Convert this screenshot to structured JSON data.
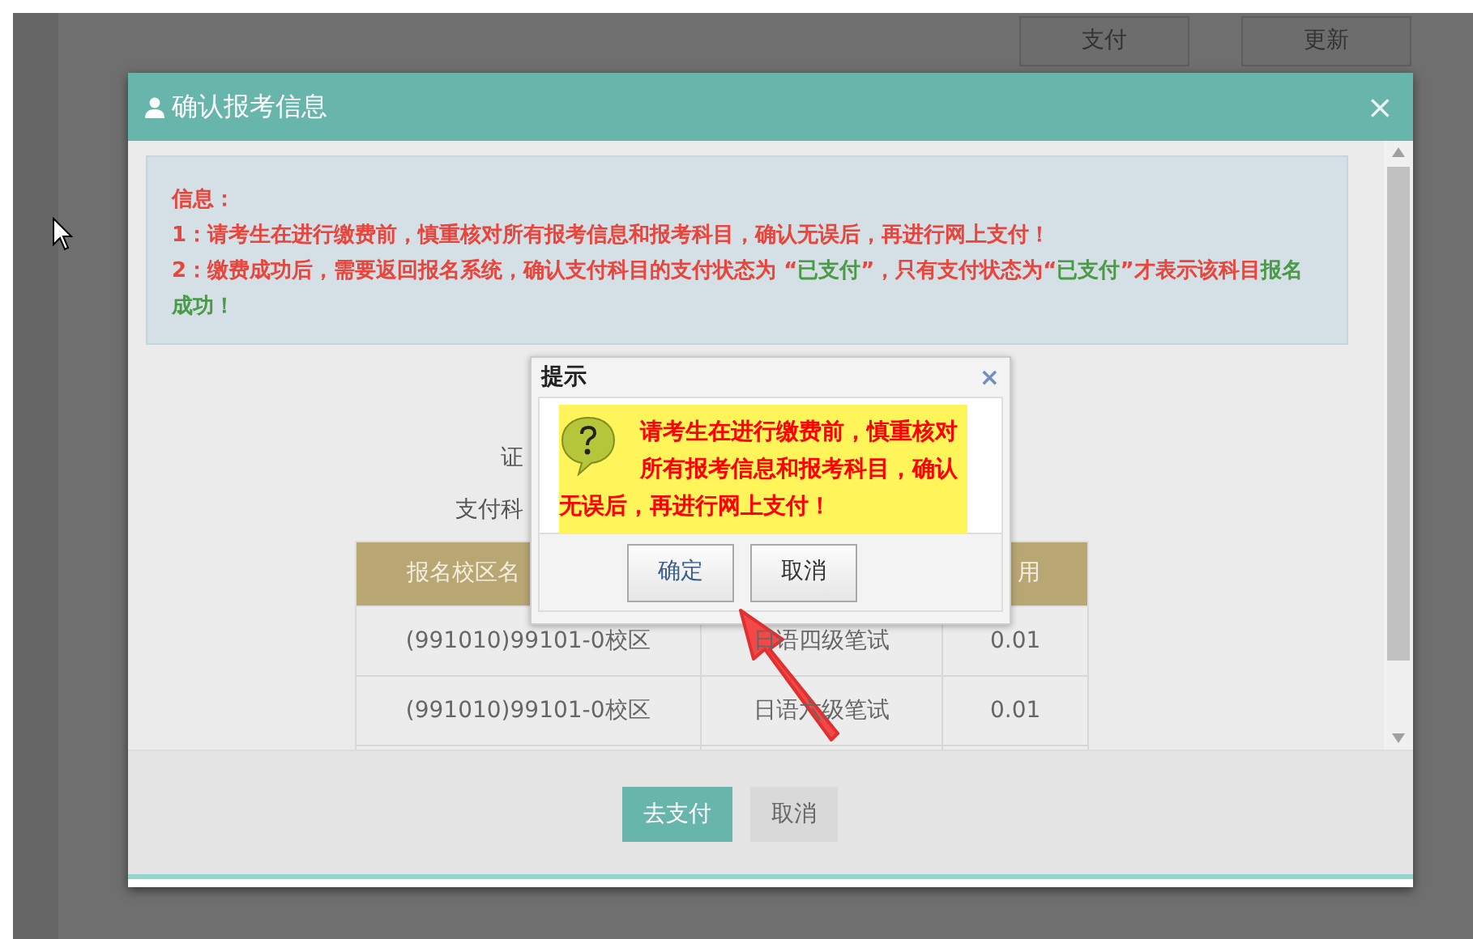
{
  "background": {
    "buttons": [
      "支付",
      "更新"
    ]
  },
  "modal": {
    "title": "确认报考信息",
    "close": "×",
    "info": {
      "heading": "信息：",
      "items": [
        [
          {
            "text": "1：请考生在进行缴费前，慎重核对所有报考信息和报考科目，确认无误后，再进行网上支付！",
            "highlight": false
          }
        ],
        [
          {
            "text": "2：缴费成功后，需要返回报名系统，确认支付科目的支付状态为 “",
            "highlight": false
          },
          {
            "text": "已支付",
            "highlight": true
          },
          {
            "text": "”，只有支付状态为“",
            "highlight": false
          },
          {
            "text": "已支付",
            "highlight": true
          },
          {
            "text": "”才表示该科目",
            "highlight": false
          },
          {
            "text": "报名成功！",
            "highlight": true
          }
        ]
      ]
    },
    "field_labels": [
      "证",
      "支付科"
    ],
    "table": {
      "columns": {
        "column_1": "报名校区名",
        "column_3": "用"
      },
      "rows": [
        [
          "(991010)99101-0校区",
          "日语四级笔试",
          "0.01"
        ],
        [
          "(991010)99101-0校区",
          "日语六级笔试",
          "0.01"
        ]
      ]
    },
    "buttons": [
      {
        "label": "去支付",
        "kind": "primary"
      },
      {
        "label": "取消",
        "kind": "secondary"
      }
    ]
  },
  "dialog": {
    "title": "提示",
    "close": "×",
    "message": "请考生在进行缴费前，慎重核对所有报考信息和报考科目，确认无误后，再进行网上支付！",
    "buttons": [
      {
        "label": "确定",
        "focused": true
      },
      {
        "label": "取消",
        "focused": false
      }
    ]
  }
}
